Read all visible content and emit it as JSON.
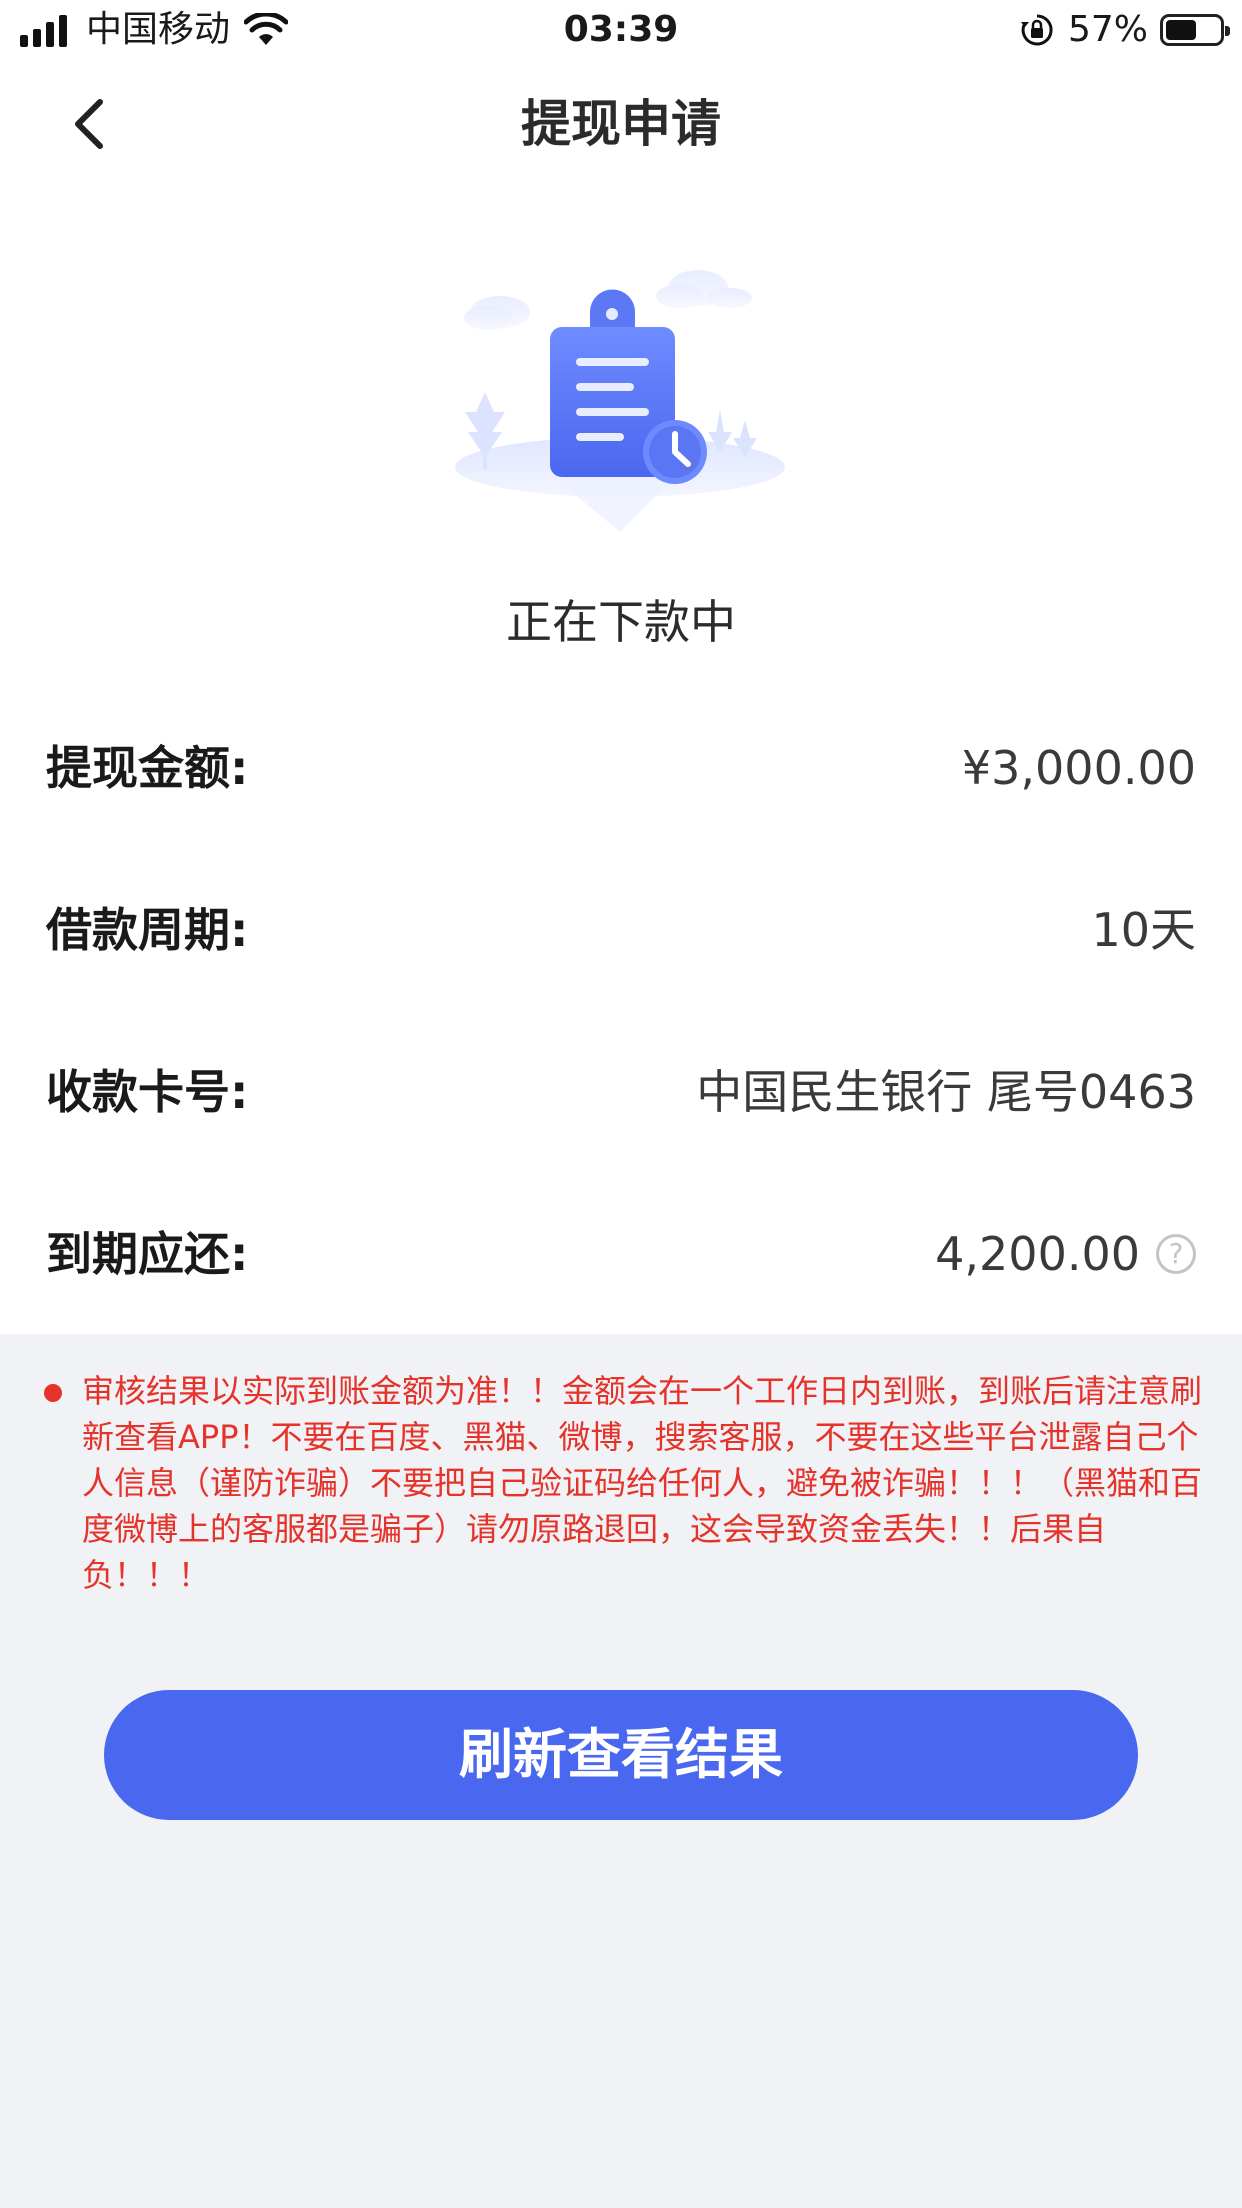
{
  "status_bar": {
    "carrier": "中国移动",
    "time": "03:39",
    "battery_percent": "57%",
    "battery_level": 0.57
  },
  "nav": {
    "title": "提现申请",
    "back_icon": "chevron-left-icon"
  },
  "status": {
    "text": "正在下款中",
    "illustration": "clipboard-clock-illustration"
  },
  "details": {
    "amount_label": "提现金额:",
    "amount_value": "¥3,000.00",
    "period_label": "借款周期:",
    "period_value": "10天",
    "card_label": "收款卡号:",
    "card_value": "中国民生银行 尾号0463",
    "due_label": "到期应还:",
    "due_value": "4,200.00",
    "help_icon": "question-circle-icon"
  },
  "notice": {
    "text": "审核结果以实际到账金额为准！！金额会在一个工作日内到账，到账后请注意刷新查看APP！不要在百度、黑猫、微博，搜索客服，不要在这些平台泄露自己个人信息（谨防诈骗）不要把自己验证码给任何人，避免被诈骗！！！（黑猫和百度微博上的客服都是骗子）请勿原路退回，这会导致资金丢失！！后果自负！！！",
    "color": "#e6332a"
  },
  "action": {
    "refresh_label": "刷新查看结果",
    "color": "#4a67f0"
  }
}
